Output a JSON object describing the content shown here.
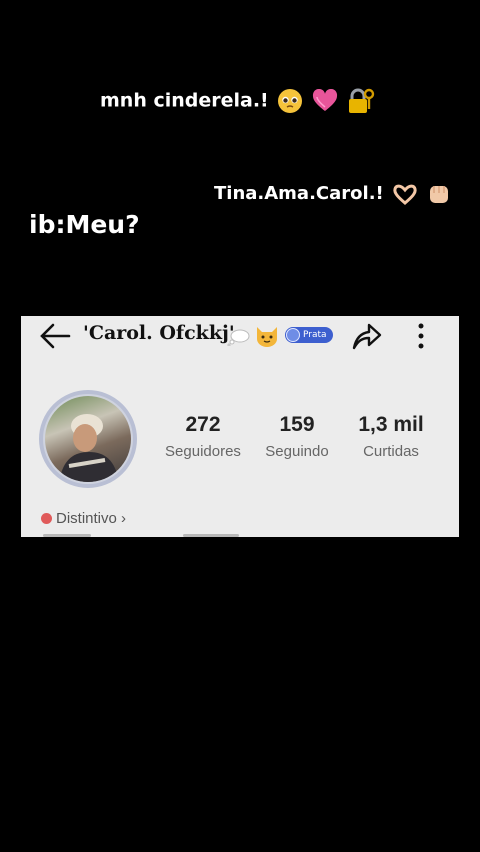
{
  "captions": {
    "top": "mnh cinderela.!",
    "right": "Tina.Ama.Carol.!",
    "left": "ib:Meu?"
  },
  "profile": {
    "username": "'Carol. Ofckkj'",
    "badge_label": "Prata",
    "stats": [
      {
        "value": "272",
        "label": "Seguidores"
      },
      {
        "value": "159",
        "label": "Seguindo"
      },
      {
        "value": "1,3 mil",
        "label": "Curtidas"
      }
    ],
    "distintivo_label": "Distintivo ›"
  },
  "colors": {
    "background": "#000000",
    "card_bg": "#ececec",
    "badge": "#3d5fcf",
    "heart": "#e8559a",
    "lock": "#e8b400"
  },
  "icons": [
    "pleading-face-icon",
    "pink-heart-icon",
    "locked-with-key-icon",
    "heart-hands-icon",
    "fist-icon",
    "back-arrow-icon",
    "thought-bubble-icon",
    "cat-face-icon",
    "share-icon",
    "more-options-icon"
  ]
}
